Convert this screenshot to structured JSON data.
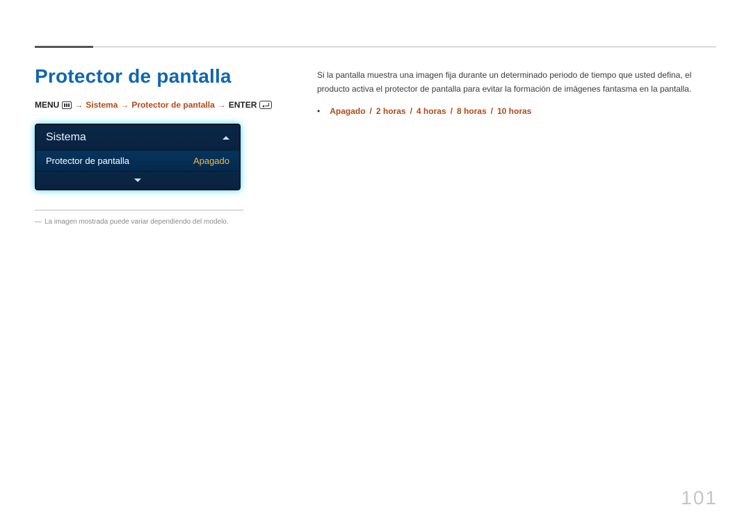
{
  "title": "Protector de pantalla",
  "breadcrumb": {
    "menu": "MENU",
    "arrow": "→",
    "sistema": "Sistema",
    "protector": "Protector de pantalla",
    "enter": "ENTER"
  },
  "osd": {
    "header": "Sistema",
    "row": {
      "label": "Protector de pantalla",
      "value": "Apagado"
    }
  },
  "note": "La imagen mostrada puede variar dependiendo del modelo.",
  "note_dash": "―",
  "body": "Si la pantalla muestra una imagen fija durante un determinado periodo de tiempo que usted defina, el producto activa el protector de pantalla para evitar la formación de imágenes fantasma en la pantalla.",
  "options": {
    "bullet": "•",
    "items": [
      "Apagado",
      "2 horas",
      "4 horas",
      "8 horas",
      "10 horas"
    ],
    "sep": "/"
  },
  "page_number": "101"
}
